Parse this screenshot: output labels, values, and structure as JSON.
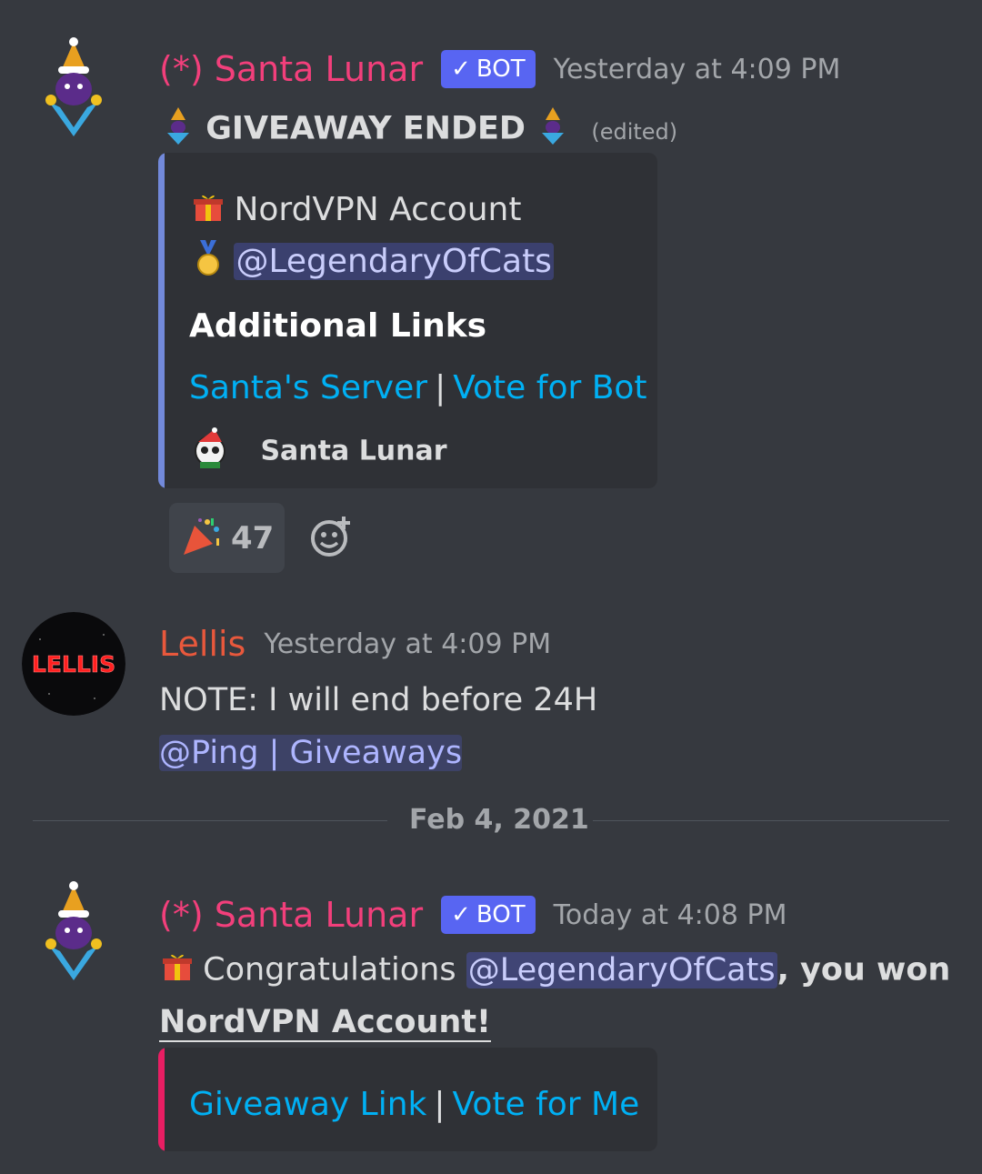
{
  "colors": {
    "background": "#36393f",
    "embed_bg": "#2f3136",
    "bot_name": "#f23f7b",
    "lellis_name": "#e8583c",
    "bot_tag": "#5865f2",
    "embed_bar_1": "#7289da",
    "embed_bar_2": "#e91e63",
    "link": "#00b0f4"
  },
  "messages": [
    {
      "author": "(*) Santa Lunar",
      "bot_tag": "BOT",
      "timestamp": "Yesterday at 4:09 PM",
      "content": "GIVEAWAY ENDED",
      "edited": "(edited)",
      "embed": {
        "prize_line": "NordVPN Account",
        "winner_mention": "@LegendaryOfCats",
        "section_title": "Additional Links",
        "links": [
          "Santa's Server",
          "Vote for Bot"
        ],
        "separator": "|",
        "footer_name": "Santa Lunar"
      },
      "reaction": {
        "emoji": "party-popper",
        "count": "47"
      }
    },
    {
      "author": "Lellis",
      "avatar_text": "LELLIS",
      "timestamp": "Yesterday at 4:09 PM",
      "content": "NOTE: I will end before 24H",
      "role_mention": "@Ping | Giveaways"
    }
  ],
  "date_divider": "Feb 4, 2021",
  "message3": {
    "author": "(*) Santa Lunar",
    "bot_tag": "BOT",
    "timestamp": "Today at 4:08 PM",
    "content_prefix": "Congratulations",
    "winner_mention": "@LegendaryOfCats",
    "content_suffix": ", you won",
    "prize": "NordVPN Account!",
    "embed": {
      "links": [
        "Giveaway Link",
        "Vote for Me"
      ],
      "separator": "|"
    }
  }
}
